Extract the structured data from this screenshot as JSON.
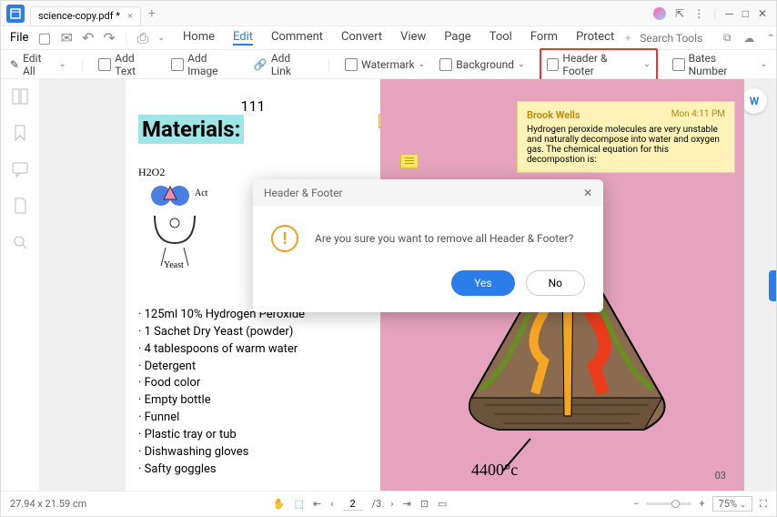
{
  "titlebar": {
    "filename": "science-copy.pdf *"
  },
  "quickbar": {
    "file": "File",
    "search_placeholder": "Search Tools"
  },
  "menu": {
    "home": "Home",
    "edit": "Edit",
    "comment": "Comment",
    "convert": "Convert",
    "view": "View",
    "page": "Page",
    "tool": "Tool",
    "form": "Form",
    "protect": "Protect"
  },
  "ribbon": {
    "editall": "Edit All",
    "addtext": "Add Text",
    "addimage": "Add Image",
    "addlink": "Add Link",
    "watermark": "Watermark",
    "background": "Background",
    "headerfooter": "Header & Footer",
    "bates": "Bates Number"
  },
  "document": {
    "page_header": "111",
    "title": "Materials:",
    "h2o2": "H2O2",
    "yeast_label": "Yeast",
    "act_label": "Act",
    "list": [
      "125ml 10% Hydrogen Peroxide",
      "1 Sachet Dry Yeast (powder)",
      "4 tablespoons of warm water",
      "Detergent",
      "Food color",
      "Empty bottle",
      "Funnel",
      "Plastic tray or tub",
      "Dishwashing gloves",
      "Safty goggles"
    ],
    "temp": "4400°c",
    "footer_page": "03"
  },
  "comment": {
    "author": "Brook Wells",
    "time": "Mon 4:11 PM",
    "text": "Hydrogen peroxide molecules are very unstable and naturally decompose into water and oxygen gas. The chemical equation for this decompostion is:"
  },
  "dialog": {
    "title": "Header & Footer",
    "message": "Are you sure you want to remove all Header & Footer?",
    "yes": "Yes",
    "no": "No"
  },
  "status": {
    "dims": "27.94 x 21.59 cm",
    "page": "2",
    "total": "/3",
    "zoom": "75%"
  }
}
